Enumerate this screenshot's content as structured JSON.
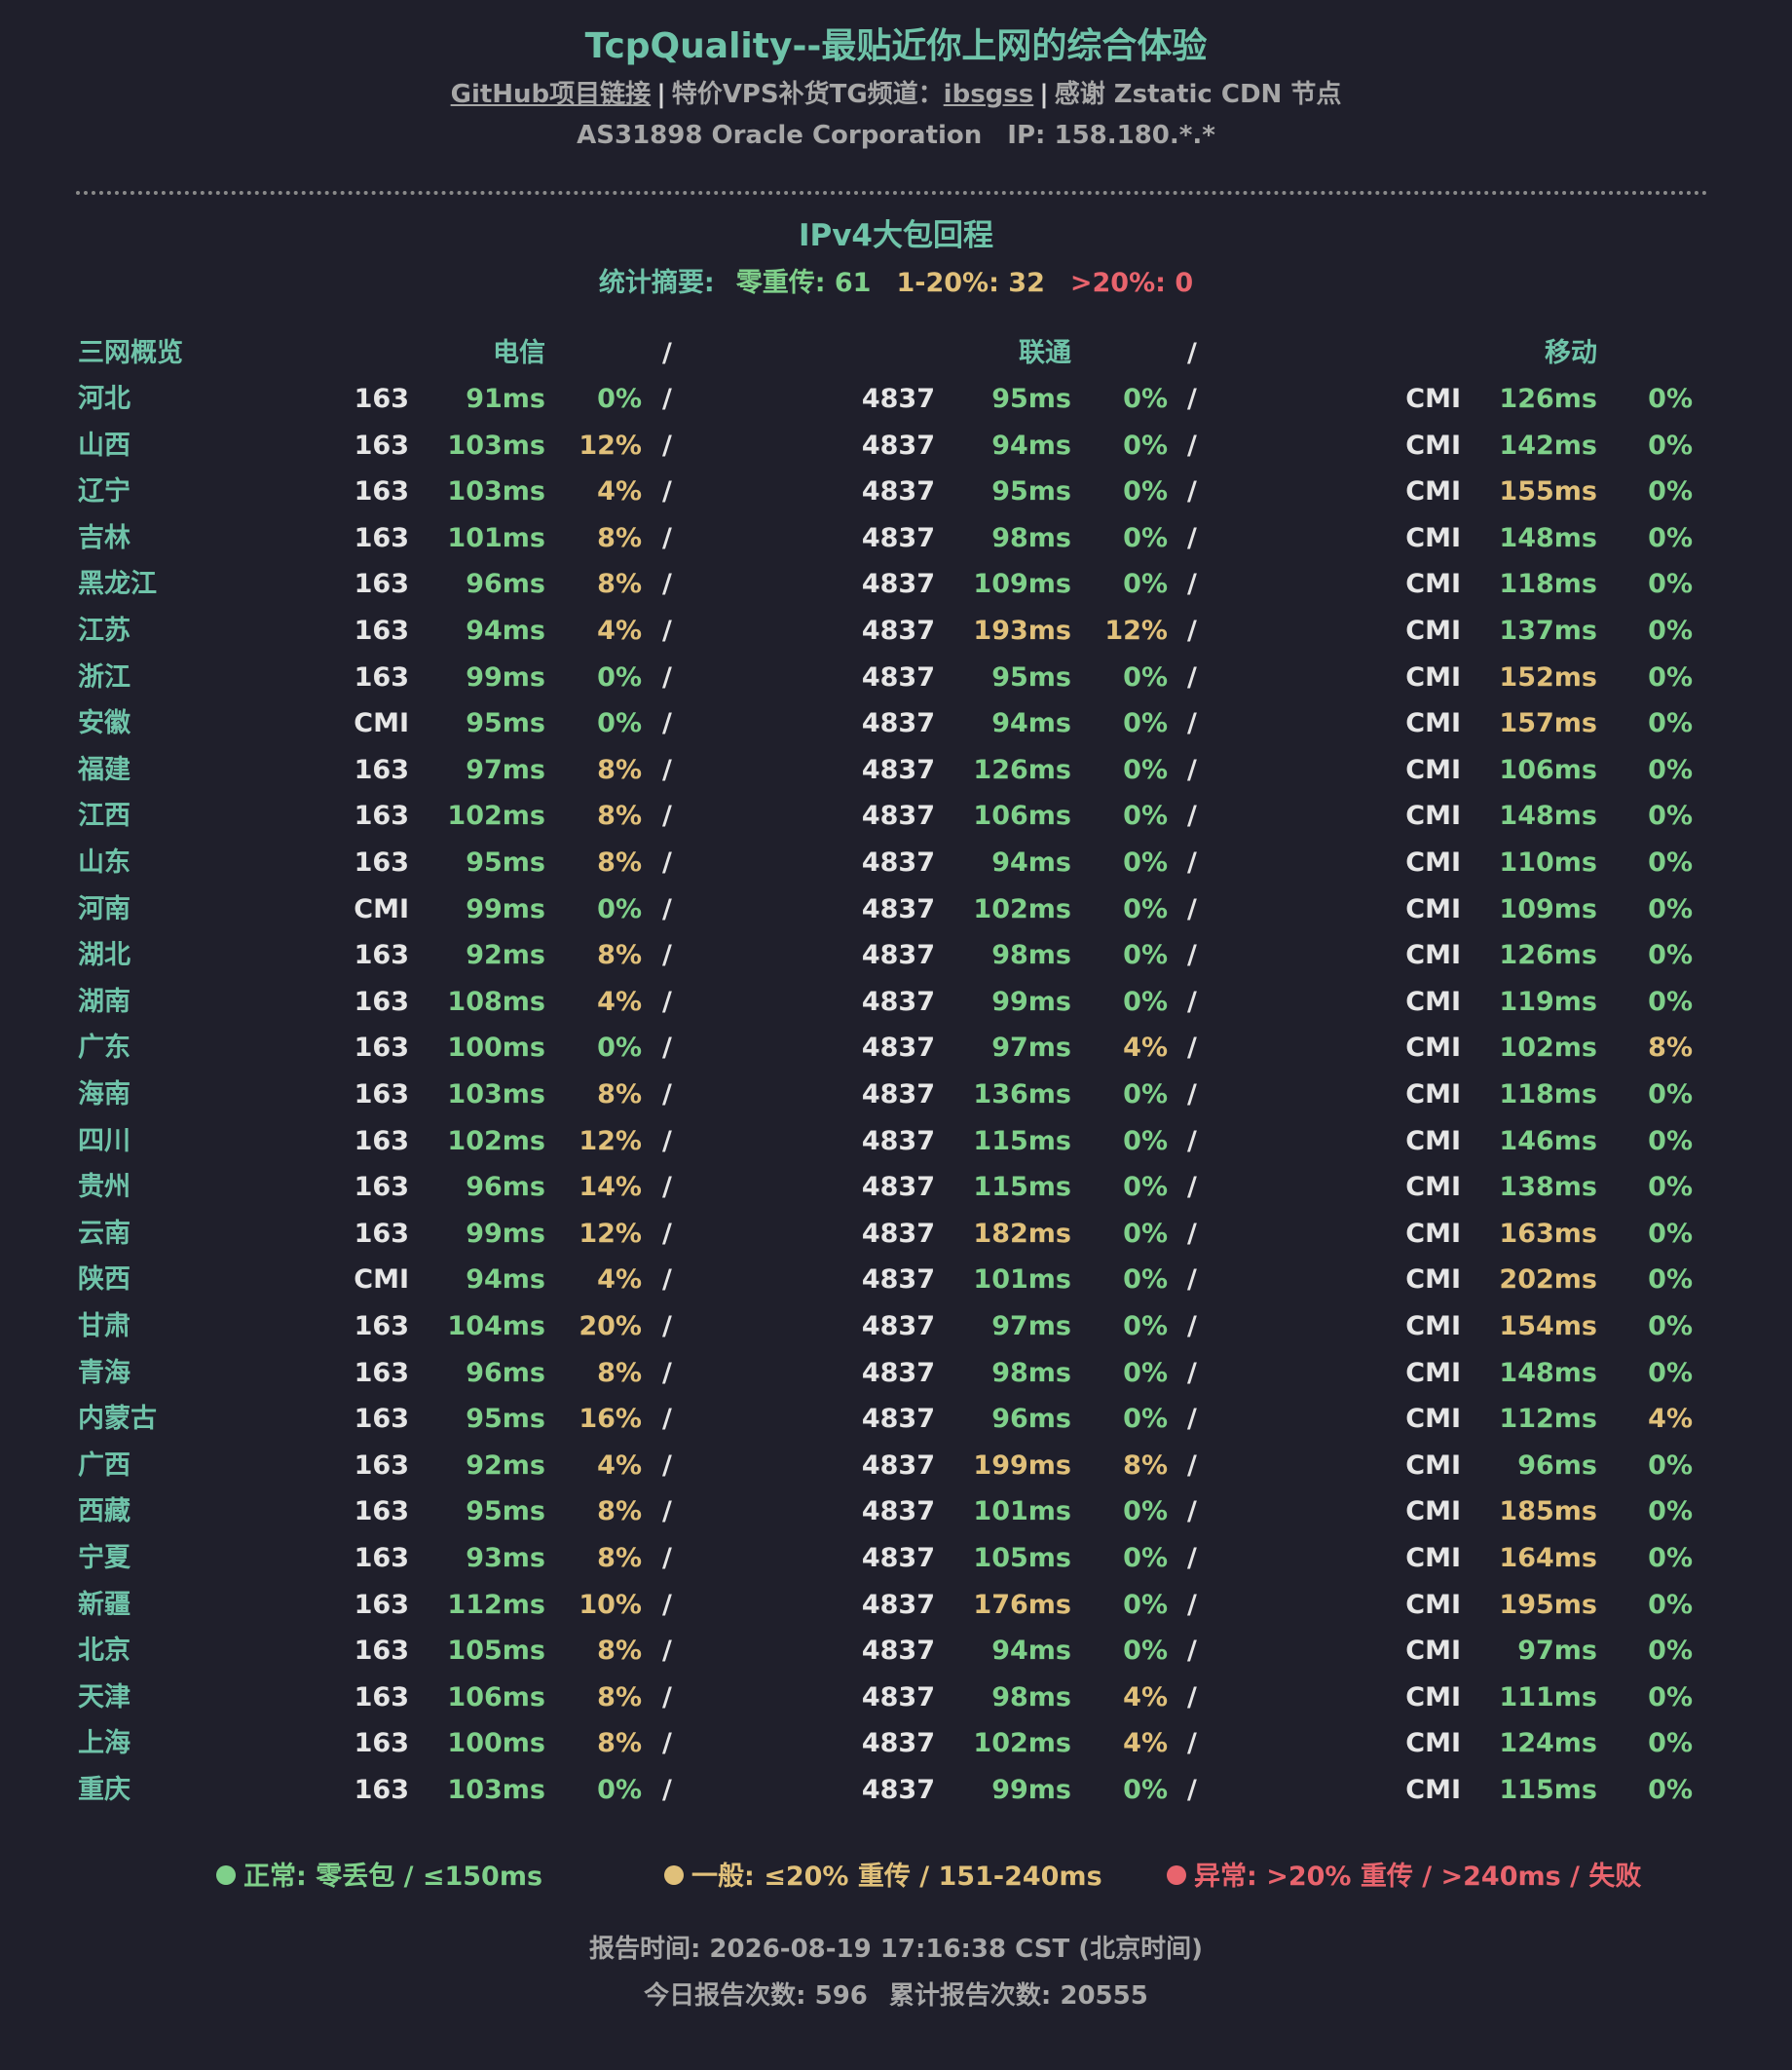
{
  "header": {
    "title": "TcpQuality--最贴近你上网的综合体验",
    "github_link": "GitHub项目链接",
    "separator": "|",
    "tg_prefix": "特价VPS补货TG频道：",
    "tg_link": "ibsgss",
    "cdn_note": "感谢 Zstatic CDN 节点",
    "asn": "AS31898 Oracle Corporation",
    "ip": "IP: 158.180.*.*"
  },
  "section": {
    "title": "IPv4大包回程",
    "summary_label": "统计摘要:",
    "summary_zero": "零重传: 61",
    "summary_mid": "1-20%: 32",
    "summary_high": ">20%: 0"
  },
  "columns": {
    "overview": "三网概览",
    "telecom": "电信",
    "unicom": "联通",
    "mobile": "移动",
    "slash": "/"
  },
  "colors": {
    "good": "#7fd08a",
    "fair": "#e0c07a",
    "bad": "#e8646d",
    "accent": "#6fc3a9",
    "background": "#1f1f2b"
  },
  "rows": [
    {
      "province": "河北",
      "t_asn": "163",
      "t_lat": "91ms",
      "t_loss": "0%",
      "u_asn": "4837",
      "u_lat": "95ms",
      "u_loss": "0%",
      "m_asn": "CMI",
      "m_lat": "126ms",
      "m_loss": "0%"
    },
    {
      "province": "山西",
      "t_asn": "163",
      "t_lat": "103ms",
      "t_loss": "12%",
      "u_asn": "4837",
      "u_lat": "94ms",
      "u_loss": "0%",
      "m_asn": "CMI",
      "m_lat": "142ms",
      "m_loss": "0%"
    },
    {
      "province": "辽宁",
      "t_asn": "163",
      "t_lat": "103ms",
      "t_loss": "4%",
      "u_asn": "4837",
      "u_lat": "95ms",
      "u_loss": "0%",
      "m_asn": "CMI",
      "m_lat": "155ms",
      "m_loss": "0%"
    },
    {
      "province": "吉林",
      "t_asn": "163",
      "t_lat": "101ms",
      "t_loss": "8%",
      "u_asn": "4837",
      "u_lat": "98ms",
      "u_loss": "0%",
      "m_asn": "CMI",
      "m_lat": "148ms",
      "m_loss": "0%"
    },
    {
      "province": "黑龙江",
      "t_asn": "163",
      "t_lat": "96ms",
      "t_loss": "8%",
      "u_asn": "4837",
      "u_lat": "109ms",
      "u_loss": "0%",
      "m_asn": "CMI",
      "m_lat": "118ms",
      "m_loss": "0%"
    },
    {
      "province": "江苏",
      "t_asn": "163",
      "t_lat": "94ms",
      "t_loss": "4%",
      "u_asn": "4837",
      "u_lat": "193ms",
      "u_loss": "12%",
      "m_asn": "CMI",
      "m_lat": "137ms",
      "m_loss": "0%"
    },
    {
      "province": "浙江",
      "t_asn": "163",
      "t_lat": "99ms",
      "t_loss": "0%",
      "u_asn": "4837",
      "u_lat": "95ms",
      "u_loss": "0%",
      "m_asn": "CMI",
      "m_lat": "152ms",
      "m_loss": "0%"
    },
    {
      "province": "安徽",
      "t_asn": "CMI",
      "t_lat": "95ms",
      "t_loss": "0%",
      "u_asn": "4837",
      "u_lat": "94ms",
      "u_loss": "0%",
      "m_asn": "CMI",
      "m_lat": "157ms",
      "m_loss": "0%"
    },
    {
      "province": "福建",
      "t_asn": "163",
      "t_lat": "97ms",
      "t_loss": "8%",
      "u_asn": "4837",
      "u_lat": "126ms",
      "u_loss": "0%",
      "m_asn": "CMI",
      "m_lat": "106ms",
      "m_loss": "0%"
    },
    {
      "province": "江西",
      "t_asn": "163",
      "t_lat": "102ms",
      "t_loss": "8%",
      "u_asn": "4837",
      "u_lat": "106ms",
      "u_loss": "0%",
      "m_asn": "CMI",
      "m_lat": "148ms",
      "m_loss": "0%"
    },
    {
      "province": "山东",
      "t_asn": "163",
      "t_lat": "95ms",
      "t_loss": "8%",
      "u_asn": "4837",
      "u_lat": "94ms",
      "u_loss": "0%",
      "m_asn": "CMI",
      "m_lat": "110ms",
      "m_loss": "0%"
    },
    {
      "province": "河南",
      "t_asn": "CMI",
      "t_lat": "99ms",
      "t_loss": "0%",
      "u_asn": "4837",
      "u_lat": "102ms",
      "u_loss": "0%",
      "m_asn": "CMI",
      "m_lat": "109ms",
      "m_loss": "0%"
    },
    {
      "province": "湖北",
      "t_asn": "163",
      "t_lat": "92ms",
      "t_loss": "8%",
      "u_asn": "4837",
      "u_lat": "98ms",
      "u_loss": "0%",
      "m_asn": "CMI",
      "m_lat": "126ms",
      "m_loss": "0%"
    },
    {
      "province": "湖南",
      "t_asn": "163",
      "t_lat": "108ms",
      "t_loss": "4%",
      "u_asn": "4837",
      "u_lat": "99ms",
      "u_loss": "0%",
      "m_asn": "CMI",
      "m_lat": "119ms",
      "m_loss": "0%"
    },
    {
      "province": "广东",
      "t_asn": "163",
      "t_lat": "100ms",
      "t_loss": "0%",
      "u_asn": "4837",
      "u_lat": "97ms",
      "u_loss": "4%",
      "m_asn": "CMI",
      "m_lat": "102ms",
      "m_loss": "8%"
    },
    {
      "province": "海南",
      "t_asn": "163",
      "t_lat": "103ms",
      "t_loss": "8%",
      "u_asn": "4837",
      "u_lat": "136ms",
      "u_loss": "0%",
      "m_asn": "CMI",
      "m_lat": "118ms",
      "m_loss": "0%"
    },
    {
      "province": "四川",
      "t_asn": "163",
      "t_lat": "102ms",
      "t_loss": "12%",
      "u_asn": "4837",
      "u_lat": "115ms",
      "u_loss": "0%",
      "m_asn": "CMI",
      "m_lat": "146ms",
      "m_loss": "0%"
    },
    {
      "province": "贵州",
      "t_asn": "163",
      "t_lat": "96ms",
      "t_loss": "14%",
      "u_asn": "4837",
      "u_lat": "115ms",
      "u_loss": "0%",
      "m_asn": "CMI",
      "m_lat": "138ms",
      "m_loss": "0%"
    },
    {
      "province": "云南",
      "t_asn": "163",
      "t_lat": "99ms",
      "t_loss": "12%",
      "u_asn": "4837",
      "u_lat": "182ms",
      "u_loss": "0%",
      "m_asn": "CMI",
      "m_lat": "163ms",
      "m_loss": "0%"
    },
    {
      "province": "陕西",
      "t_asn": "CMI",
      "t_lat": "94ms",
      "t_loss": "4%",
      "u_asn": "4837",
      "u_lat": "101ms",
      "u_loss": "0%",
      "m_asn": "CMI",
      "m_lat": "202ms",
      "m_loss": "0%"
    },
    {
      "province": "甘肃",
      "t_asn": "163",
      "t_lat": "104ms",
      "t_loss": "20%",
      "u_asn": "4837",
      "u_lat": "97ms",
      "u_loss": "0%",
      "m_asn": "CMI",
      "m_lat": "154ms",
      "m_loss": "0%"
    },
    {
      "province": "青海",
      "t_asn": "163",
      "t_lat": "96ms",
      "t_loss": "8%",
      "u_asn": "4837",
      "u_lat": "98ms",
      "u_loss": "0%",
      "m_asn": "CMI",
      "m_lat": "148ms",
      "m_loss": "0%"
    },
    {
      "province": "内蒙古",
      "t_asn": "163",
      "t_lat": "95ms",
      "t_loss": "16%",
      "u_asn": "4837",
      "u_lat": "96ms",
      "u_loss": "0%",
      "m_asn": "CMI",
      "m_lat": "112ms",
      "m_loss": "4%"
    },
    {
      "province": "广西",
      "t_asn": "163",
      "t_lat": "92ms",
      "t_loss": "4%",
      "u_asn": "4837",
      "u_lat": "199ms",
      "u_loss": "8%",
      "m_asn": "CMI",
      "m_lat": "96ms",
      "m_loss": "0%"
    },
    {
      "province": "西藏",
      "t_asn": "163",
      "t_lat": "95ms",
      "t_loss": "8%",
      "u_asn": "4837",
      "u_lat": "101ms",
      "u_loss": "0%",
      "m_asn": "CMI",
      "m_lat": "185ms",
      "m_loss": "0%"
    },
    {
      "province": "宁夏",
      "t_asn": "163",
      "t_lat": "93ms",
      "t_loss": "8%",
      "u_asn": "4837",
      "u_lat": "105ms",
      "u_loss": "0%",
      "m_asn": "CMI",
      "m_lat": "164ms",
      "m_loss": "0%"
    },
    {
      "province": "新疆",
      "t_asn": "163",
      "t_lat": "112ms",
      "t_loss": "10%",
      "u_asn": "4837",
      "u_lat": "176ms",
      "u_loss": "0%",
      "m_asn": "CMI",
      "m_lat": "195ms",
      "m_loss": "0%"
    },
    {
      "province": "北京",
      "t_asn": "163",
      "t_lat": "105ms",
      "t_loss": "8%",
      "u_asn": "4837",
      "u_lat": "94ms",
      "u_loss": "0%",
      "m_asn": "CMI",
      "m_lat": "97ms",
      "m_loss": "0%"
    },
    {
      "province": "天津",
      "t_asn": "163",
      "t_lat": "106ms",
      "t_loss": "8%",
      "u_asn": "4837",
      "u_lat": "98ms",
      "u_loss": "4%",
      "m_asn": "CMI",
      "m_lat": "111ms",
      "m_loss": "0%"
    },
    {
      "province": "上海",
      "t_asn": "163",
      "t_lat": "100ms",
      "t_loss": "8%",
      "u_asn": "4837",
      "u_lat": "102ms",
      "u_loss": "4%",
      "m_asn": "CMI",
      "m_lat": "124ms",
      "m_loss": "0%"
    },
    {
      "province": "重庆",
      "t_asn": "163",
      "t_lat": "103ms",
      "t_loss": "0%",
      "u_asn": "4837",
      "u_lat": "99ms",
      "u_loss": "0%",
      "m_asn": "CMI",
      "m_lat": "115ms",
      "m_loss": "0%"
    }
  ],
  "legend": {
    "normal": "正常: 零丢包 / ≤150ms",
    "fair": "一般: ≤20% 重传 / 151-240ms",
    "abnormal": "异常: >20% 重传 / >240ms / 失败"
  },
  "footer": {
    "report_time": "报告时间: 2026-08-19 17:16:38 CST (北京时间)",
    "today_count": "今日报告次数: 596",
    "total_count": "累计报告次数: 20555"
  }
}
